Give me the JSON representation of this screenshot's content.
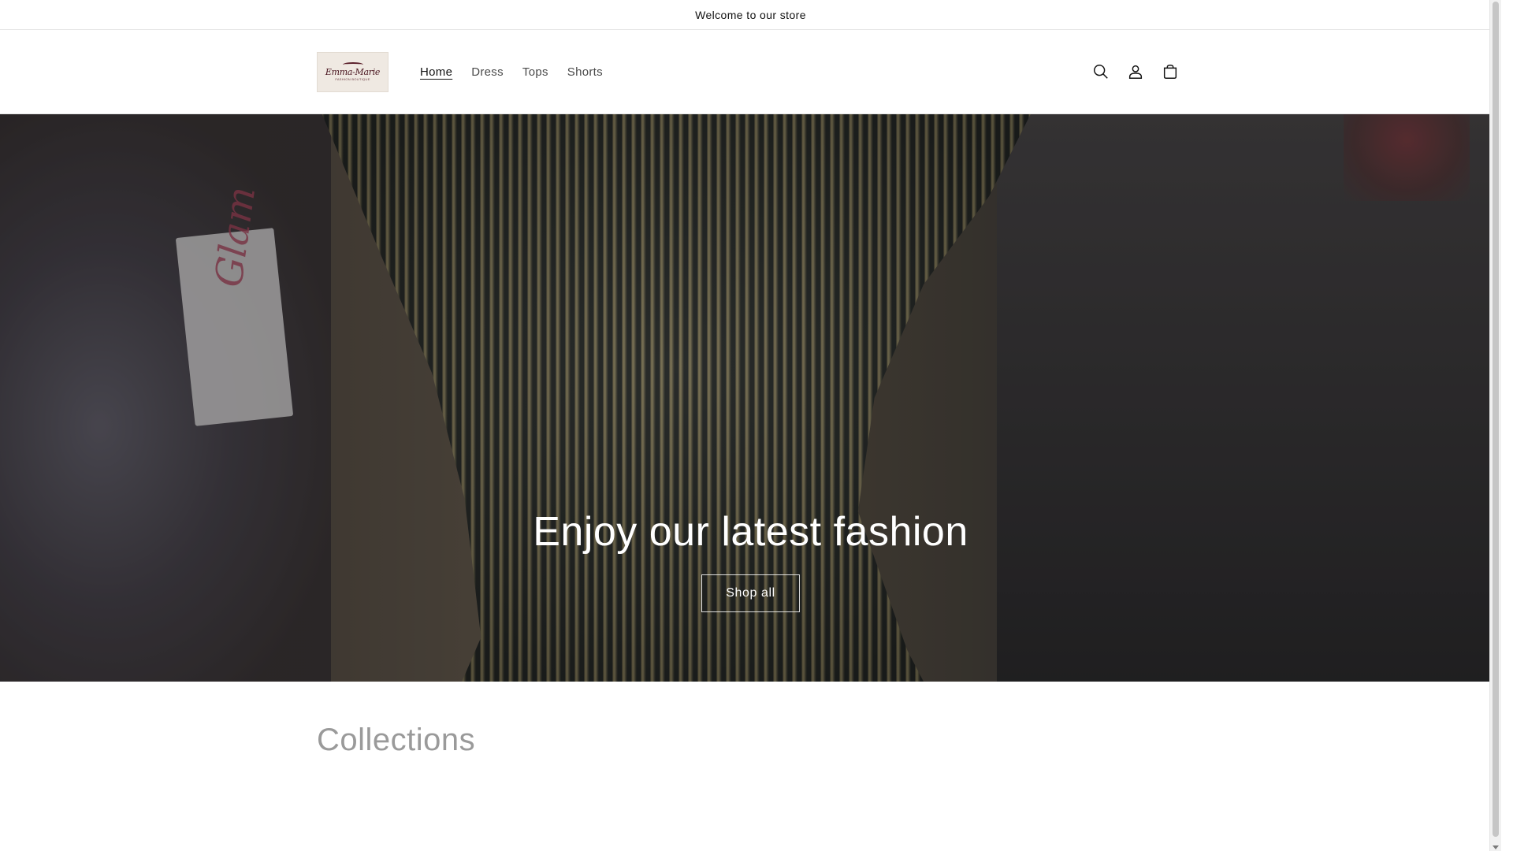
{
  "announcement": {
    "text": "Welcome to our store"
  },
  "header": {
    "logo": {
      "name": "Emma-Marie",
      "tagline": "FASHION BOUTIQUE"
    },
    "nav": [
      {
        "label": "Home",
        "active": true
      },
      {
        "label": "Dress",
        "active": false
      },
      {
        "label": "Tops",
        "active": false
      },
      {
        "label": "Shorts",
        "active": false
      }
    ],
    "icons": [
      "search-icon",
      "account-icon",
      "cart-icon"
    ]
  },
  "hero": {
    "title": "Enjoy our latest fashion",
    "button_label": "Shop all",
    "tag_text": "Glam"
  },
  "collections": {
    "title": "Collections"
  },
  "colors": {
    "text": "#121212",
    "muted": "#9a9a9a",
    "hero_overlay": "#000000"
  }
}
